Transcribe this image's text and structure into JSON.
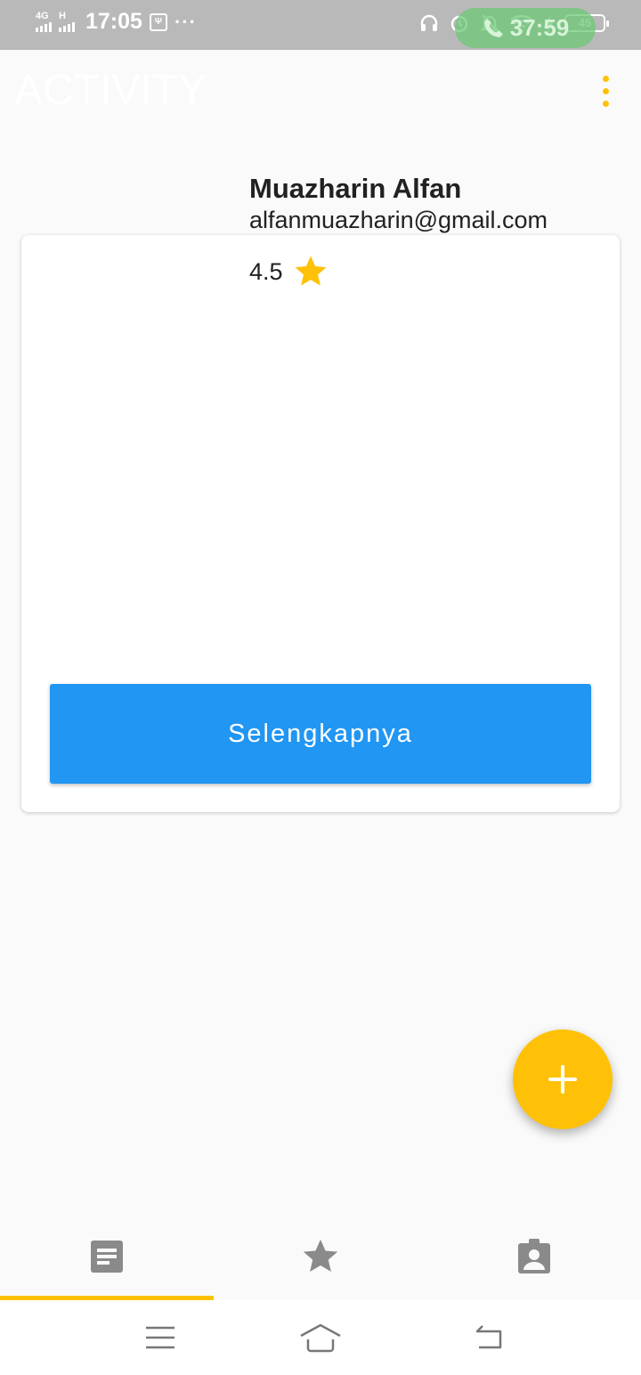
{
  "status_bar": {
    "network_1": "4G",
    "network_2": "H",
    "time": "17:05",
    "usb_label": "Ψ",
    "more": "···",
    "call_timer": "37:59",
    "battery": "45"
  },
  "appbar": {
    "title": "ACTIVITY"
  },
  "profile": {
    "name": "Muazharin Alfan",
    "email": "alfanmuazharin@gmail.com",
    "rating": "4.5"
  },
  "card": {
    "button_label": "Selengkapnya"
  },
  "bottom_nav": {
    "tabs": [
      {
        "icon": "document-icon",
        "selected": true
      },
      {
        "icon": "star-icon",
        "selected": false
      },
      {
        "icon": "contact-card-icon",
        "selected": false
      }
    ]
  },
  "colors": {
    "accent": "#ffc107",
    "button": "#2196f3",
    "status_bar": "#b9b9b9"
  }
}
